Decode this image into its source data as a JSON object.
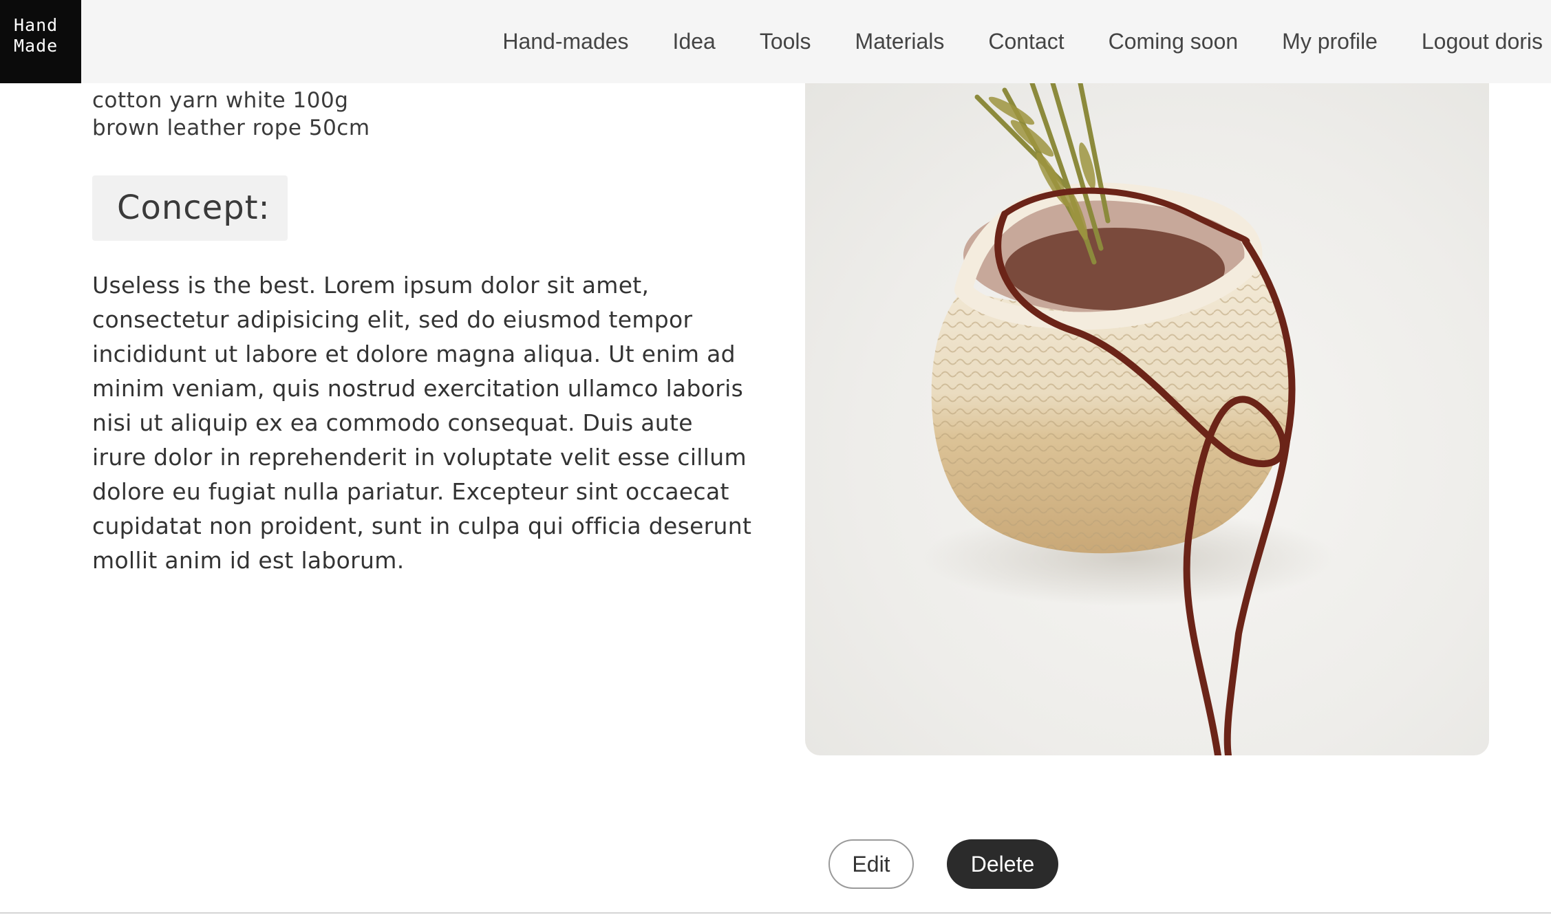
{
  "header": {
    "logo_line1": "Hand",
    "logo_line2": "Made",
    "nav": [
      "Hand-mades",
      "Idea",
      "Tools",
      "Materials",
      "Contact",
      "Coming soon",
      "My profile",
      "Logout doris"
    ]
  },
  "materials": {
    "items": [
      "cotton yarn white 100g",
      "brown leather rope 50cm"
    ]
  },
  "concept": {
    "heading": "Concept:",
    "text": "Useless is the best. Lorem ipsum dolor sit amet, consectetur adipisicing elit, sed do eiusmod tempor incididunt ut labore et dolore magna aliqua. Ut enim ad minim veniam, quis nostrud exercitation ullamco laboris nisi ut aliquip ex ea commodo consequat. Duis aute irure dolor in reprehenderit in voluptate velit esse cillum dolore eu fugiat nulla pariatur. Excepteur sint occaecat cupidatat non proident, sunt in culpa qui officia deserunt mollit anim id est laborum."
  },
  "actions": {
    "edit_label": "Edit",
    "delete_label": "Delete"
  },
  "colors": {
    "header_bg": "#f5f5f5",
    "logo_bg": "#0b0b0b",
    "delete_bg": "#2b2b2b",
    "rope": "#6b2418",
    "yarn": "#efe3cc",
    "jute": "#d6bb8c"
  }
}
